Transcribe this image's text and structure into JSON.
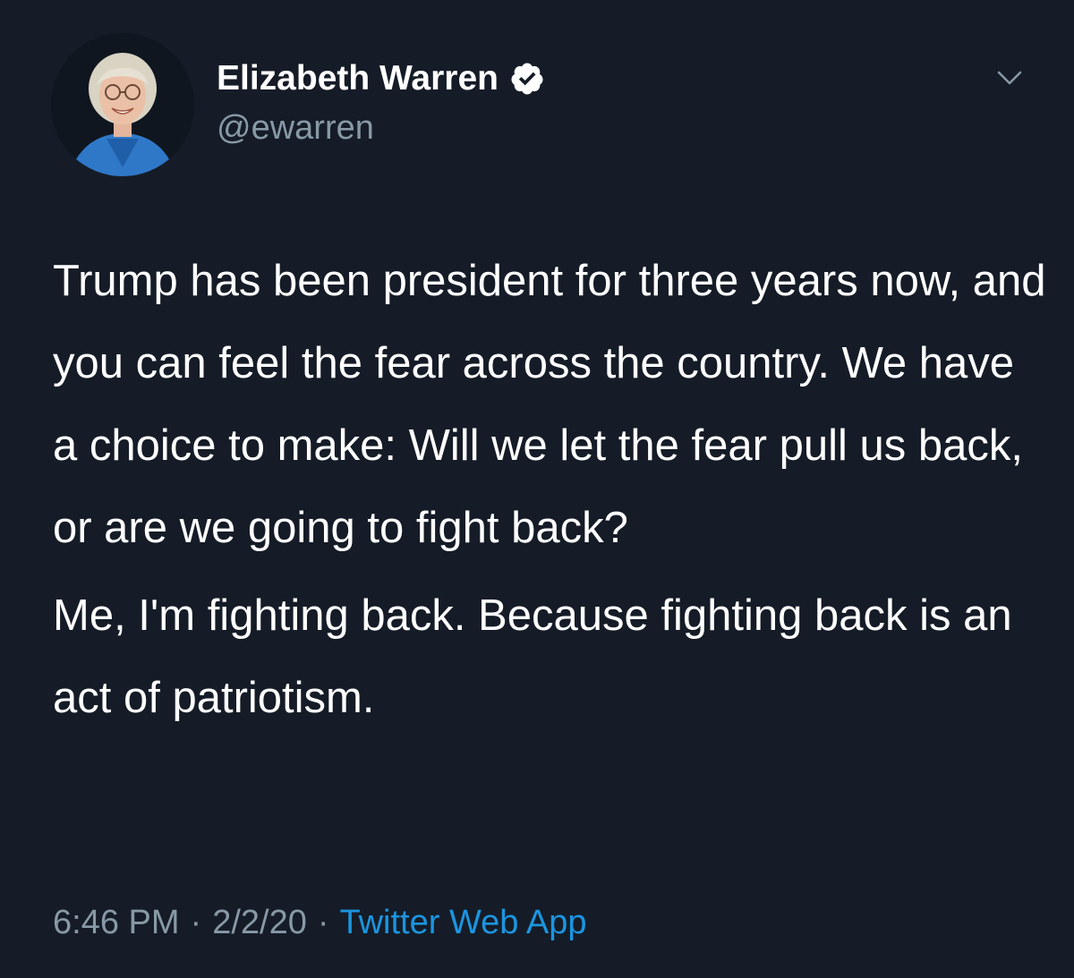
{
  "author": {
    "name": "Elizabeth Warren",
    "handle": "@ewarren",
    "verified": true,
    "avatar_icon": "profile-photo"
  },
  "menu": {
    "icon": "chevron-down-icon"
  },
  "tweet": {
    "paragraphs": [
      "Trump has been president for three years now, and you can feel the fear across the country. We have a choice to make: Will we let the fear pull us back, or are we going to fight back?",
      "Me, I'm fighting back. Because fighting back is an act of patriotism."
    ],
    "time": "6:46 PM",
    "date": "2/2/20",
    "separator": "·",
    "source": "Twitter Web App"
  },
  "colors": {
    "background": "#151c27",
    "text": "#ffffff",
    "muted": "#8899a6",
    "link": "#1b95e0"
  }
}
